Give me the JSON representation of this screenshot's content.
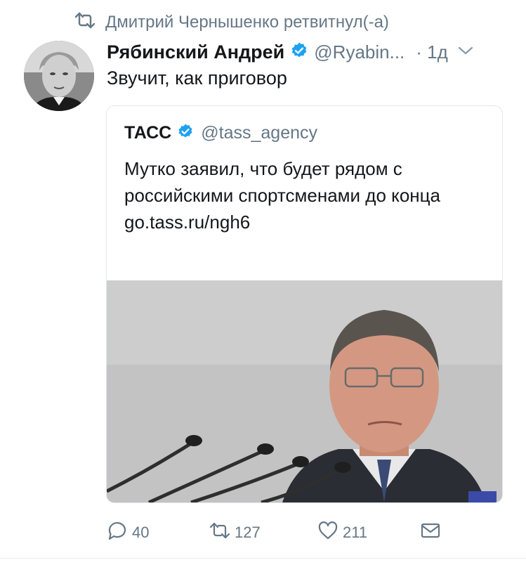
{
  "retweet_context": {
    "icon": "retweet-icon",
    "text": "Дмитрий Чернышенко ретвитнул(-а)"
  },
  "tweet": {
    "display_name": "Рябинский Андрей",
    "handle": "@Ryabin...",
    "time": "· 1д",
    "text": "Звучит, как приговор",
    "verified_color": "#1da1f2"
  },
  "quoted": {
    "display_name": "ТАСС",
    "handle": "@tass_agency",
    "text": "Мутко заявил, что будет рядом с российскими спортсменами до конца",
    "link": "go.tass.ru/ngh6"
  },
  "actions": {
    "replies": "40",
    "retweets": "127",
    "likes": "211"
  },
  "colors": {
    "text": "#14171a",
    "secondary": "#657786",
    "border": "#e1e8ed"
  }
}
